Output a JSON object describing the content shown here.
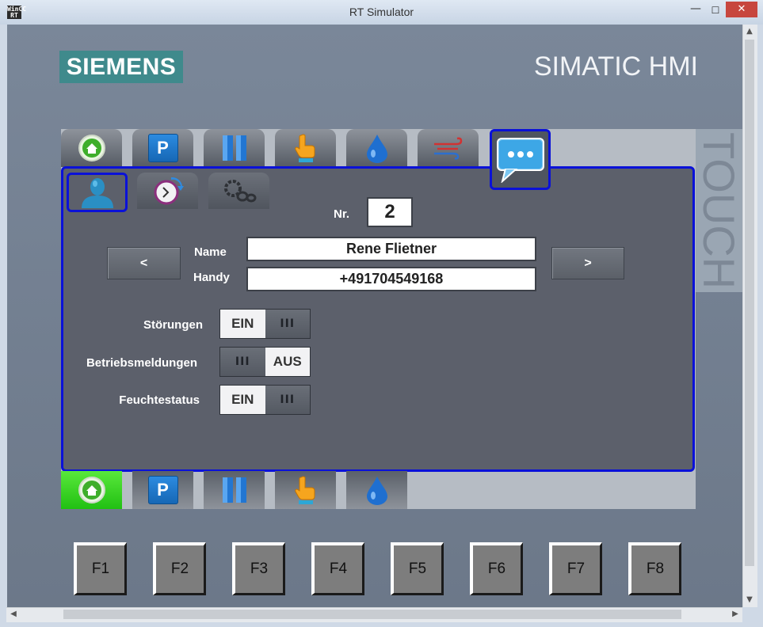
{
  "window": {
    "app_icon_text": "WinCC RT",
    "title": "RT Simulator",
    "minimize_glyph": "—",
    "maximize_glyph": "☐",
    "close_glyph": "✕"
  },
  "scrollbar": {
    "up": "▲",
    "down": "▼",
    "left": "◀",
    "right": "▶"
  },
  "hmi": {
    "brand": "SIEMENS",
    "product": "SIMATIC HMI",
    "side_label": "TOUCH"
  },
  "top_nav": [
    {
      "icon": "home-icon"
    },
    {
      "icon": "parking-icon",
      "text": "P"
    },
    {
      "icon": "pause-icon"
    },
    {
      "icon": "hand-pointer-icon"
    },
    {
      "icon": "water-drop-icon"
    },
    {
      "icon": "wind-icon"
    },
    {
      "icon": "message-bubble-icon",
      "selected": true
    }
  ],
  "sub_tabs": [
    {
      "icon": "person-icon",
      "selected": true
    },
    {
      "icon": "history-clock-icon"
    },
    {
      "icon": "chain-icon"
    }
  ],
  "contact": {
    "nr_label": "Nr.",
    "nr_value": "2",
    "name_label": "Name",
    "name_value": "Rene Flietner",
    "phone_label": "Handy",
    "phone_value": "+491704549168",
    "prev_label": "<",
    "next_label": ">"
  },
  "toggles": [
    {
      "label": "Störungen",
      "state": "EIN",
      "grip": "III"
    },
    {
      "label": "Betriebsmeldungen",
      "state": "AUS",
      "grip": "III"
    },
    {
      "label": "Feuchtestatus",
      "state": "EIN",
      "grip": "III"
    }
  ],
  "bottom_nav": [
    {
      "icon": "home-icon",
      "active": true
    },
    {
      "icon": "parking-icon",
      "text": "P"
    },
    {
      "icon": "pause-icon"
    },
    {
      "icon": "hand-pointer-icon"
    },
    {
      "icon": "water-drop-icon"
    }
  ],
  "function_keys": [
    "F1",
    "F2",
    "F3",
    "F4",
    "F5",
    "F6",
    "F7",
    "F8"
  ],
  "colors": {
    "highlight": "#0a11d8",
    "active_tab": "#21c012",
    "brand": "#3f8a8c"
  }
}
